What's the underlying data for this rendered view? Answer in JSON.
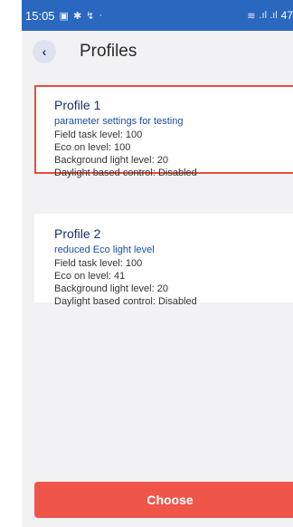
{
  "statusbar": {
    "time": "15:05",
    "icons": [
      "gallery-icon",
      "bluetooth-icon",
      "nfc-icon",
      "dot-icon"
    ],
    "right_text": "47"
  },
  "header": {
    "back_icon": "chevron-left-icon",
    "title": "Profiles"
  },
  "profiles": [
    {
      "title": "Profile 1",
      "description": "parameter settings for testing",
      "field_task": "Field task level: 100",
      "eco_on": "Eco on level: 100",
      "background": "Background light level: 20",
      "daylight": "Daylight based control: Disabled",
      "selected": true
    },
    {
      "title": "Profile 2",
      "description": "reduced Eco light level",
      "field_task": "Field task level: 100",
      "eco_on": "Eco on level: 41",
      "background": "Background light level: 20",
      "daylight": "Daylight based control: Disabled",
      "selected": false
    }
  ],
  "actions": {
    "choose_label": "Choose"
  },
  "colors": {
    "statusbar": "#2a67bf",
    "accent": "#f0554a",
    "selected_border": "#e84b3c",
    "background": "#f2f2f4"
  }
}
